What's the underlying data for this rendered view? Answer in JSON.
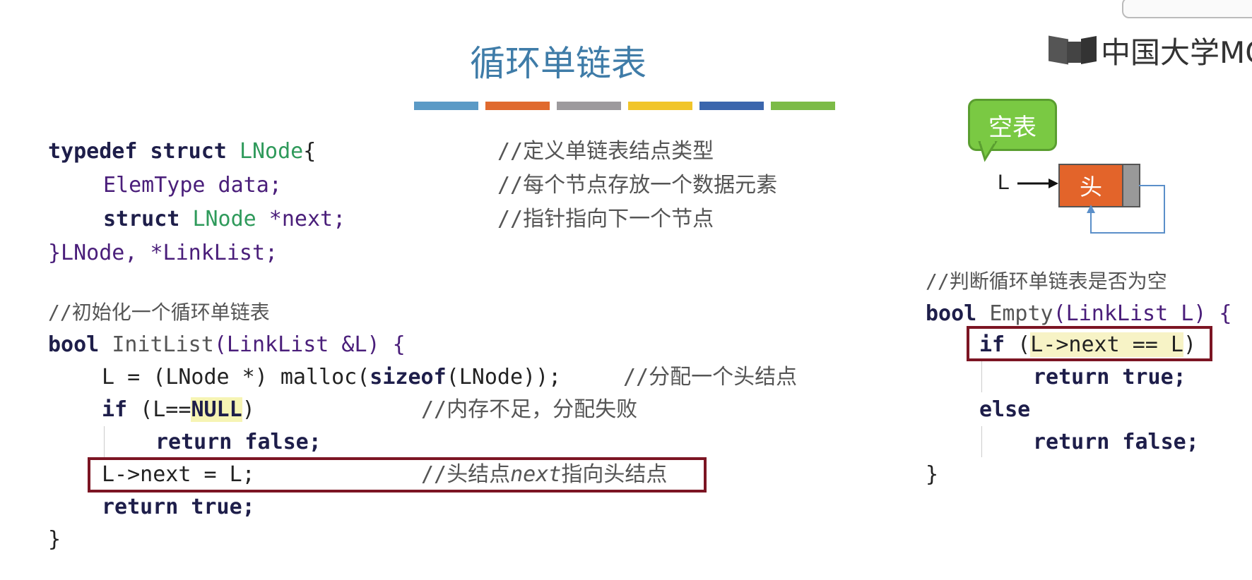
{
  "title": "循环单链表",
  "logo_text": "中国大学MC",
  "color_bars": [
    "#5b9ac6",
    "#e06a2e",
    "#9d9a9d",
    "#f1c52a",
    "#3b66ad",
    "#7cbb47"
  ],
  "diagram": {
    "bubble_label": "空表",
    "pointer_label": "L",
    "head_label": "头"
  },
  "code_left": {
    "struct": {
      "kw_typedef": "typedef",
      "kw_struct": "struct",
      "type_lnode": "LNode",
      "brace_open": "{",
      "elemtype": "ElemType",
      "data_field": " data;",
      "kw_struct2": "struct",
      "type_lnode2": "LNode",
      "next_field": " *next;",
      "closing": "}LNode, *LinkList;",
      "comment1": "//定义单链表结点类型",
      "comment2": "//每个节点存放一个数据元素",
      "comment3": "//指针指向下一个节点"
    },
    "init": {
      "comment_header": "//初始化一个循环单链表",
      "kw_bool": "bool",
      "fn_name": "InitList",
      "fn_params": "(LinkList &L) {",
      "malloc_line": "L = (LNode *) malloc(",
      "kw_sizeof": "sizeof",
      "malloc_tail": "(LNode));",
      "comment_malloc": "//分配一个头结点",
      "kw_if": "if",
      "if_open": " (L==",
      "null_kw": "NULL",
      "if_close": ")",
      "comment_null": "//内存不足，分配失败",
      "return_false": "return false;",
      "next_line": "L->next = L;",
      "comment_next_a": "//头结点",
      "comment_next_b": "next",
      "comment_next_c": "指向头结点",
      "return_true": "return true;",
      "closing": "}"
    }
  },
  "code_right": {
    "comment_header": "//判断循环单链表是否为空",
    "kw_bool": "bool",
    "fn_name": "Empty",
    "fn_params": "(LinkList L) {",
    "kw_if": "if",
    "if_paren_open": " (",
    "if_cond": "L->next == L",
    "if_paren_close": ")",
    "return_true": "return true;",
    "kw_else": "else",
    "return_false": "return false;",
    "closing": "}"
  }
}
